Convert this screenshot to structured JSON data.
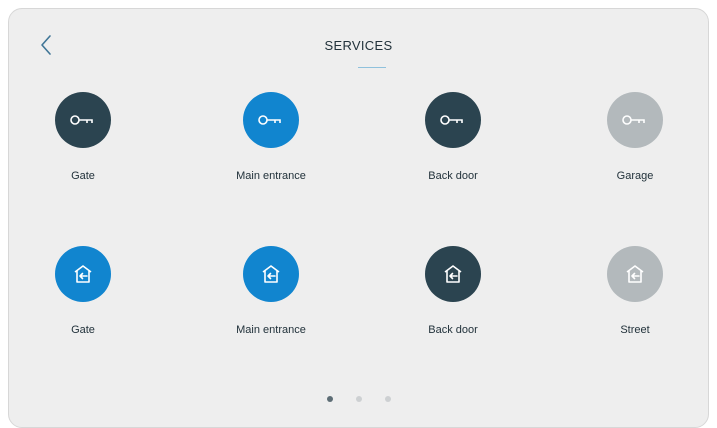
{
  "header": {
    "title": "SERVICES"
  },
  "colors": {
    "dark": "#2b4450",
    "blue": "#1185cf",
    "gray": "#b3b9bc",
    "dot_active": "#5d6d75",
    "dot_inactive": "#cdd0d2",
    "accent": "#8fc1dc"
  },
  "row1": [
    {
      "label": "Gate",
      "icon": "key-icon",
      "color": "#2b4450"
    },
    {
      "label": "Main entrance",
      "icon": "key-icon",
      "color": "#1185cf"
    },
    {
      "label": "Back door",
      "icon": "key-icon",
      "color": "#2b4450"
    },
    {
      "label": "Garage",
      "icon": "key-icon",
      "color": "#b3b9bc"
    }
  ],
  "row2": [
    {
      "label": "Gate",
      "icon": "home-enter-icon",
      "color": "#1185cf"
    },
    {
      "label": "Main entrance",
      "icon": "home-enter-icon",
      "color": "#1185cf"
    },
    {
      "label": "Back door",
      "icon": "home-enter-icon",
      "color": "#2b4450"
    },
    {
      "label": "Street",
      "icon": "home-enter-icon",
      "color": "#b3b9bc"
    }
  ],
  "pagination": {
    "current": 1,
    "total": 3
  }
}
